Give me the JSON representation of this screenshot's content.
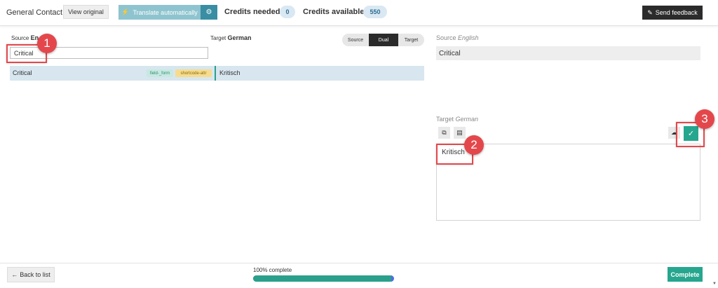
{
  "header": {
    "doc_title": "General Contact",
    "view_original_label": "View original",
    "translate_auto_label": "Translate automatically",
    "credits_needed_label": "Credits needed",
    "credits_needed_value": "0",
    "credits_available_label": "Credits available",
    "credits_available_value": "550",
    "feedback_label": "Send feedback"
  },
  "list": {
    "source_label": "Source",
    "source_lang": "En",
    "target_label": "Target",
    "target_lang": "German",
    "search_value": "Critical",
    "toggle": [
      "Source",
      "Dual",
      "Target"
    ],
    "toggle_active": "Dual",
    "rows": [
      {
        "source": "Critical",
        "tags": [
          "field-_form",
          "shortcode-attr"
        ],
        "target": "Kritisch"
      }
    ]
  },
  "editor": {
    "source_label": "Source",
    "source_lang": "English",
    "source_text": "Critical",
    "target_label": "Target",
    "target_lang": "German",
    "target_text": "Kritisch"
  },
  "callouts": [
    "1",
    "2",
    "3"
  ],
  "footer": {
    "back_label": "Back to list",
    "progress_text": "100% complete",
    "progress": 0.98,
    "complete_label": "Complete"
  },
  "colors": {
    "accent": "#26a68e",
    "callout": "#e4474b",
    "row_highlight": "#d7e6ef",
    "dark_button": "#2b2b2b"
  },
  "icons": [
    "bolt-icon",
    "gear-icon",
    "pencil-icon",
    "copy-icon",
    "glossary-icon",
    "cloud-icon",
    "check-icon",
    "arrow-left-icon"
  ]
}
